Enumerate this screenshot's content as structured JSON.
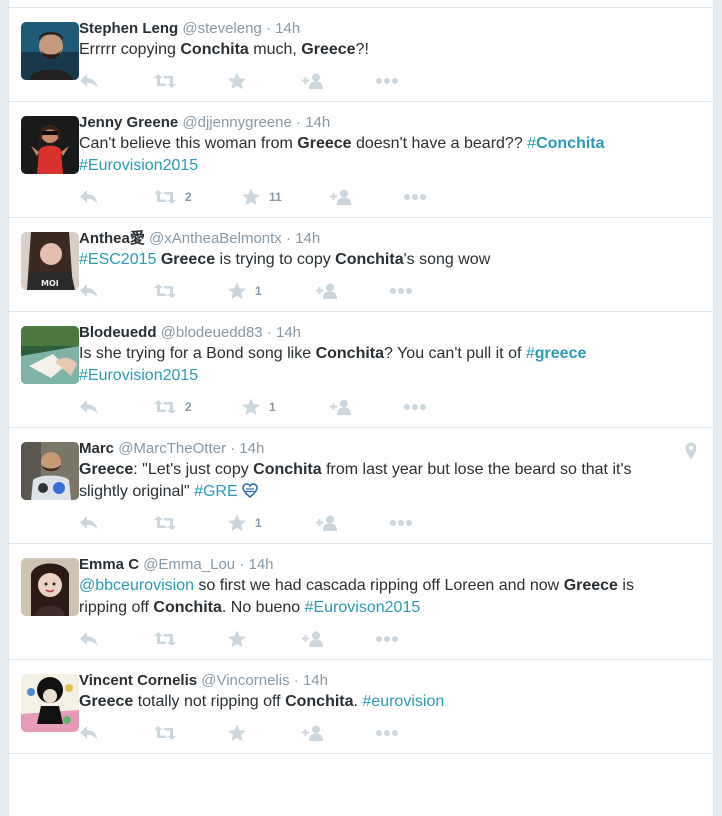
{
  "colors": {
    "link": "#2b9bb5",
    "muted": "#8899a6",
    "icon": "#ccd6dd"
  },
  "tweets": [
    {
      "name": "Stephen Leng",
      "handle": "@steveleng",
      "sep": "·",
      "time": "14h",
      "text": [
        {
          "t": "Errrrr copying "
        },
        {
          "b": "Conchita"
        },
        {
          "t": " much, "
        },
        {
          "b": "Greece"
        },
        {
          "t": "?!"
        }
      ],
      "retweets": "",
      "favorites": ""
    },
    {
      "name": "Jenny Greene",
      "handle": "@djjennygreene",
      "sep": "·",
      "time": "14h",
      "text": [
        {
          "t": "Can't believe this woman from "
        },
        {
          "b": "Greece"
        },
        {
          "t": " doesn't have a beard?? "
        },
        {
          "tag": "#",
          "tagb": "Conchita"
        },
        {
          "br": true
        },
        {
          "tag": "#Eurovision2015"
        }
      ],
      "retweets": "2",
      "favorites": "11"
    },
    {
      "name": "Anthea愛",
      "handle": "@xAntheaBelmontx",
      "sep": "·",
      "time": "14h",
      "text": [
        {
          "tag": "#ESC2015"
        },
        {
          "t": " "
        },
        {
          "b": "Greece"
        },
        {
          "t": " is trying to copy "
        },
        {
          "b": "Conchita"
        },
        {
          "t": "'s song wow"
        }
      ],
      "retweets": "",
      "favorites": "1"
    },
    {
      "name": "Blodeuedd",
      "handle": "@blodeuedd83",
      "sep": "·",
      "time": "14h",
      "text": [
        {
          "t": "Is she trying for a Bond song like "
        },
        {
          "b": "Conchita"
        },
        {
          "t": "? You can't pull it of "
        },
        {
          "tag": "#",
          "tagb": "greece"
        },
        {
          "br": true
        },
        {
          "tag": "#Eurovision2015"
        }
      ],
      "retweets": "2",
      "favorites": "1"
    },
    {
      "name": "Marc",
      "handle": "@MarcTheOtter",
      "sep": "·",
      "time": "14h",
      "text": [
        {
          "b": "Greece"
        },
        {
          "t": ": \"Let's just copy "
        },
        {
          "b": "Conchita"
        },
        {
          "t": " from last year but lose the beard so that it's"
        },
        {
          "br": true
        },
        {
          "t": "slightly original\" "
        },
        {
          "tag": "#GRE"
        }
      ],
      "retweets": "",
      "favorites": "1",
      "geo": true,
      "heart": true
    },
    {
      "name": "Emma C",
      "handle": "@Emma_Lou",
      "sep": "·",
      "time": "14h",
      "text": [
        {
          "tag": "@bbceurovision"
        },
        {
          "t": " so first we had cascada ripping off Loreen and now "
        },
        {
          "b": "Greece"
        },
        {
          "t": " is"
        },
        {
          "br": true
        },
        {
          "t": "ripping off "
        },
        {
          "b": "Conchita"
        },
        {
          "t": ". No bueno "
        },
        {
          "tag": "#Eurovison2015"
        }
      ],
      "retweets": "",
      "favorites": ""
    },
    {
      "name": "Vincent Cornelis",
      "handle": "@Vincornelis",
      "sep": "·",
      "time": "14h",
      "text": [
        {
          "b": "Greece"
        },
        {
          "t": " totally not ripping off "
        },
        {
          "b": "Conchita"
        },
        {
          "t": ". "
        },
        {
          "tag": "#eurovision"
        }
      ],
      "retweets": "",
      "favorites": ""
    }
  ]
}
